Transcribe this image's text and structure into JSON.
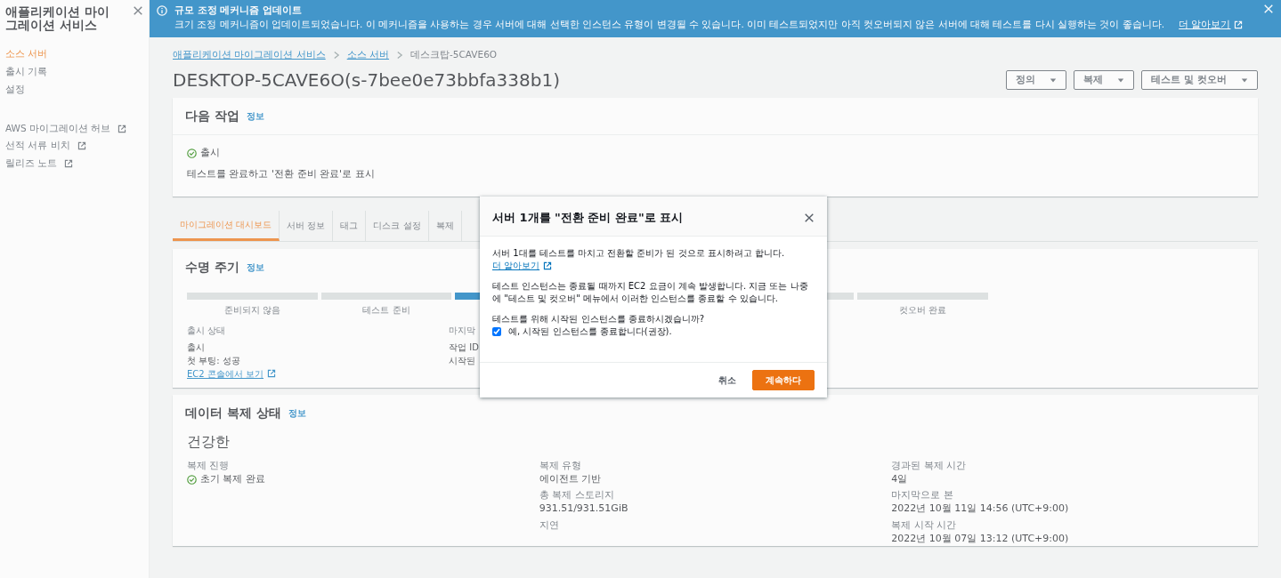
{
  "sidebar": {
    "title": "애플리케이션 마이그레이션 서비스",
    "nav": [
      {
        "label": "소스 서버",
        "selected": true
      },
      {
        "label": "출시 기록",
        "selected": false
      },
      {
        "label": "설정",
        "selected": false
      }
    ],
    "links": [
      {
        "label": "AWS 마이그레이션 허브"
      },
      {
        "label": "선적 서류 비치"
      },
      {
        "label": "릴리즈 노트"
      }
    ]
  },
  "banner": {
    "title": "규모 조정 메커니즘 업데이트",
    "message": "크기 조정 메커니즘이 업데이트되었습니다. 이 메커니즘을 사용하는 경우 서버에 대해 선택한 인스턴스 유형이 변경될 수 있습니다. 이미 테스트되었지만 아직 컷오버되지 않은 서버에 대해 테스트를 다시 실행하는 것이 좋습니다.",
    "link": "더 알아보기"
  },
  "breadcrumbs": [
    "애플리케이션 마이그레이션 서비스",
    "소스 서버",
    "데스크탑-5CAVE6O"
  ],
  "page_title": "DESKTOP-5CAVE6O(s-7bee0e73bbfa338b1)",
  "actions": [
    "정의",
    "복제",
    "테스트 및 컷오버"
  ],
  "next_action": {
    "title": "다음 작업",
    "info": "정보",
    "status": "출시",
    "text": "테스트를 완료하고 '전환 준비 완료'로 표시"
  },
  "tabs": [
    {
      "label": "마이그레이션 대시보드",
      "selected": true
    },
    {
      "label": "서버 정보",
      "selected": false
    },
    {
      "label": "태그",
      "selected": false
    },
    {
      "label": "디스크 설정",
      "selected": false
    },
    {
      "label": "복제",
      "selected": false
    }
  ],
  "lifecycle": {
    "title": "수명 주기",
    "info": "정보",
    "steps": [
      {
        "label": "준비되지 않음",
        "current": false
      },
      {
        "label": "테스트 준비",
        "current": false
      },
      {
        "current": true
      },
      {
        "label": "컷오버 완료",
        "current": false
      }
    ],
    "columns": [
      [
        {
          "kind": "label",
          "text": "출시 상태"
        },
        {
          "kind": "value",
          "text": "출시"
        },
        {
          "kind": "value",
          "text": "첫 부팅: 성공"
        },
        {
          "kind": "link",
          "text": "EC2 콘솔에서 보기"
        }
      ],
      [
        {
          "kind": "label",
          "text": "마지막"
        },
        {
          "kind": "value",
          "text": "작업 ID"
        },
        {
          "kind": "value",
          "text": "시작된"
        }
      ]
    ]
  },
  "replication": {
    "title": "데이터 복제 상태",
    "info": "정보",
    "health": "건강한",
    "columns": [
      [
        {
          "label": "복제 진행",
          "value": "초기 복제 완료",
          "kind": "status"
        }
      ],
      [
        {
          "label": "복제 유형",
          "value": "에이전트 기반",
          "kind": "text"
        },
        {
          "label": "총 복제 스토리지",
          "value": "931.51/931.51GiB",
          "kind": "text"
        },
        {
          "label": "지연"
        }
      ],
      [
        {
          "label": "경과된 복제 시간",
          "value": "4일",
          "kind": "text"
        },
        {
          "label": "마지막으로 본",
          "value": "2022년 10월 11일 14:56 (UTC+9:00)",
          "kind": "text"
        },
        {
          "label": "복제 시작 시간",
          "value": "2022년 10월 07일 13:12 (UTC+9:00)",
          "kind": "text"
        }
      ]
    ]
  },
  "modal": {
    "title": "서버 1개를 \"전환 준비 완료\"로 표시",
    "intro": "서버 1대를 테스트를 마치고 전환할 준비가 된 것으로 표시하려고 합니다.",
    "link": "더 알아보기",
    "note": "테스트 인스턴스는 종료될 때까지 EC2 요금이 계속 발생합니다. 지금 또는 나중에 \"테스트 및 컷오버\" 메뉴에서 이러한 인스턴스를 종료할 수 있습니다.",
    "question": "테스트를 위해 시작된 인스턴스를 종료하시겠습니까?",
    "checkbox": {
      "label": "예, 시작된 인스턴스를 종료합니다(권장).",
      "checked": true
    },
    "cancel": "취소",
    "confirm": "계속하다"
  }
}
